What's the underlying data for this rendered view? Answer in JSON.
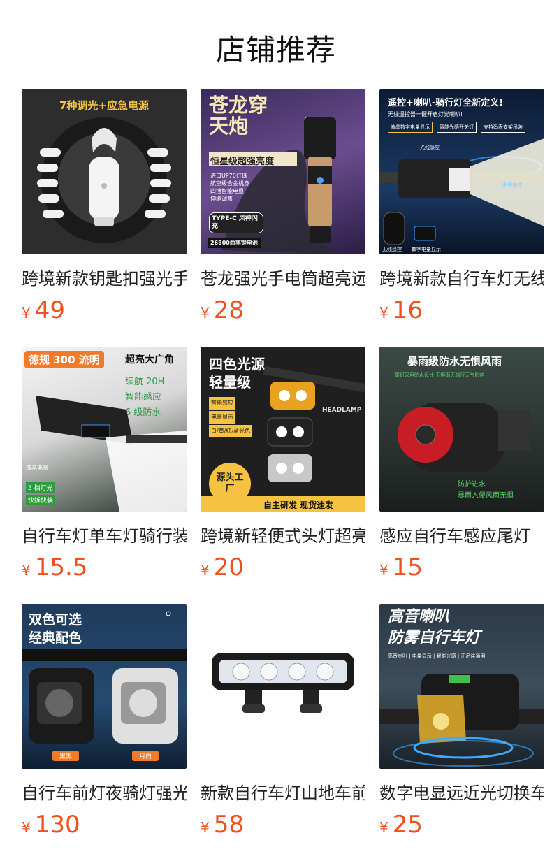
{
  "section": {
    "title": "店铺推荐"
  },
  "currency": "¥",
  "products": [
    {
      "name": "跨境新款钥匙扣强光手电筒",
      "price": "49",
      "thumb": {
        "headline": "7种调光+应急电源"
      }
    },
    {
      "name": "苍龙强光手电筒超亮远射",
      "price": "28",
      "thumb": {
        "headline": "苍龙穿天炮",
        "banner": "恒星级超强亮度",
        "specs": [
          "进口UP70灯珠",
          "航空级合金机身",
          "四挡智能电显",
          "伸缩调焦"
        ],
        "badge": "TYPE-C 风神闪充",
        "battery": "26800曲率锂电池"
      }
    },
    {
      "name": "跨境新款自行车灯无线遥控",
      "price": "16",
      "thumb": {
        "headline": "遥控+喇叭-骑行灯全新定义!",
        "sub": "无线遥控器一键开启灯光喇叭!",
        "tags": [
          "液晶数字电量显示",
          "智能光感开关灯",
          "支持码表支架吊装"
        ],
        "labels": [
          "光线感应",
          "无线遥控",
          "无线遥控",
          "数字电量显示"
        ]
      }
    },
    {
      "name": "自行车灯单车灯骑行装备",
      "price": "15.5",
      "thumb": {
        "headline": "德规 300 流明",
        "headline2": "超亮大广角",
        "features": [
          "续航 20H",
          "智能感应",
          "6 级防水"
        ],
        "labels": [
          "液晶电量",
          "5 档灯光",
          "快拆快装"
        ]
      }
    },
    {
      "name": "跨境新轻便式头灯超亮",
      "price": "20",
      "thumb": {
        "headline": "四色光源",
        "headline2": "轻量级",
        "features": [
          "智能感应",
          "电量显示",
          "白/黄/红/蓝光色"
        ],
        "stamp": "源头工厂",
        "footer": "自主研发 现货速发",
        "brand": "HEADLAMP"
      }
    },
    {
      "name": "感应自行车感应尾灯",
      "price": "15",
      "thumb": {
        "headline": "暴雨级防水无惧风雨",
        "sub": "尾灯采用防水设计,无惧雨天骑行天气影响",
        "labels": [
          "防护进水",
          "暴雨入侵风雨无惧"
        ]
      }
    },
    {
      "name": "自行车前灯夜骑灯强光",
      "price": "130",
      "thumb": {
        "headline": "双色可选",
        "headline2": "经典配色",
        "options": [
          "黑黑",
          "月白"
        ]
      }
    },
    {
      "name": "新款自行车灯山地车前灯",
      "price": "58",
      "thumb": {}
    },
    {
      "name": "数字电显远近光切换车灯",
      "price": "25",
      "thumb": {
        "headline": "高音喇叭",
        "headline2": "防雾自行车灯",
        "sub": "高音喇叭 | 电量显示 | 智能光感 | 正吊装通用"
      }
    }
  ]
}
